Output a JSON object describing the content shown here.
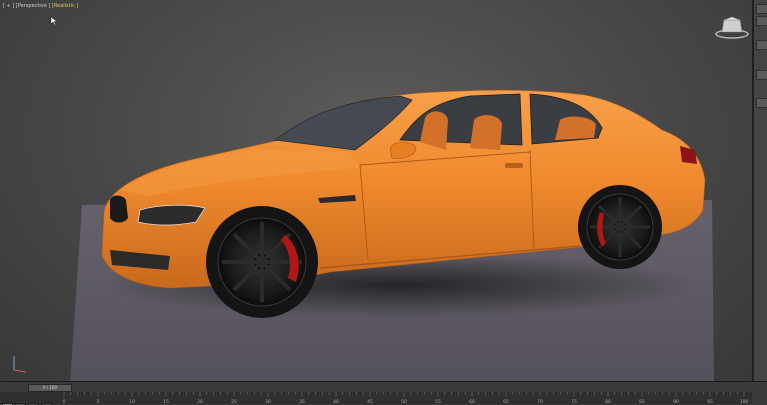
{
  "viewport": {
    "label_bracket": "[ + ]",
    "label_view": "[Perspective ]",
    "label_mode": "[Realistic ]"
  },
  "timeline": {
    "slider_text": "0 / 100",
    "ticks": [
      "0",
      "5",
      "10",
      "15",
      "20",
      "25",
      "30",
      "35",
      "40",
      "45",
      "50",
      "55",
      "60",
      "65",
      "70",
      "75",
      "80",
      "85",
      "90",
      "95",
      "100"
    ]
  },
  "colors": {
    "car_body": "#f08a2e",
    "viewport_bg": "#4a4a4a",
    "ground": "#5c5860"
  },
  "icons": [
    "mouse-cursor-icon",
    "viewcube-icon"
  ]
}
